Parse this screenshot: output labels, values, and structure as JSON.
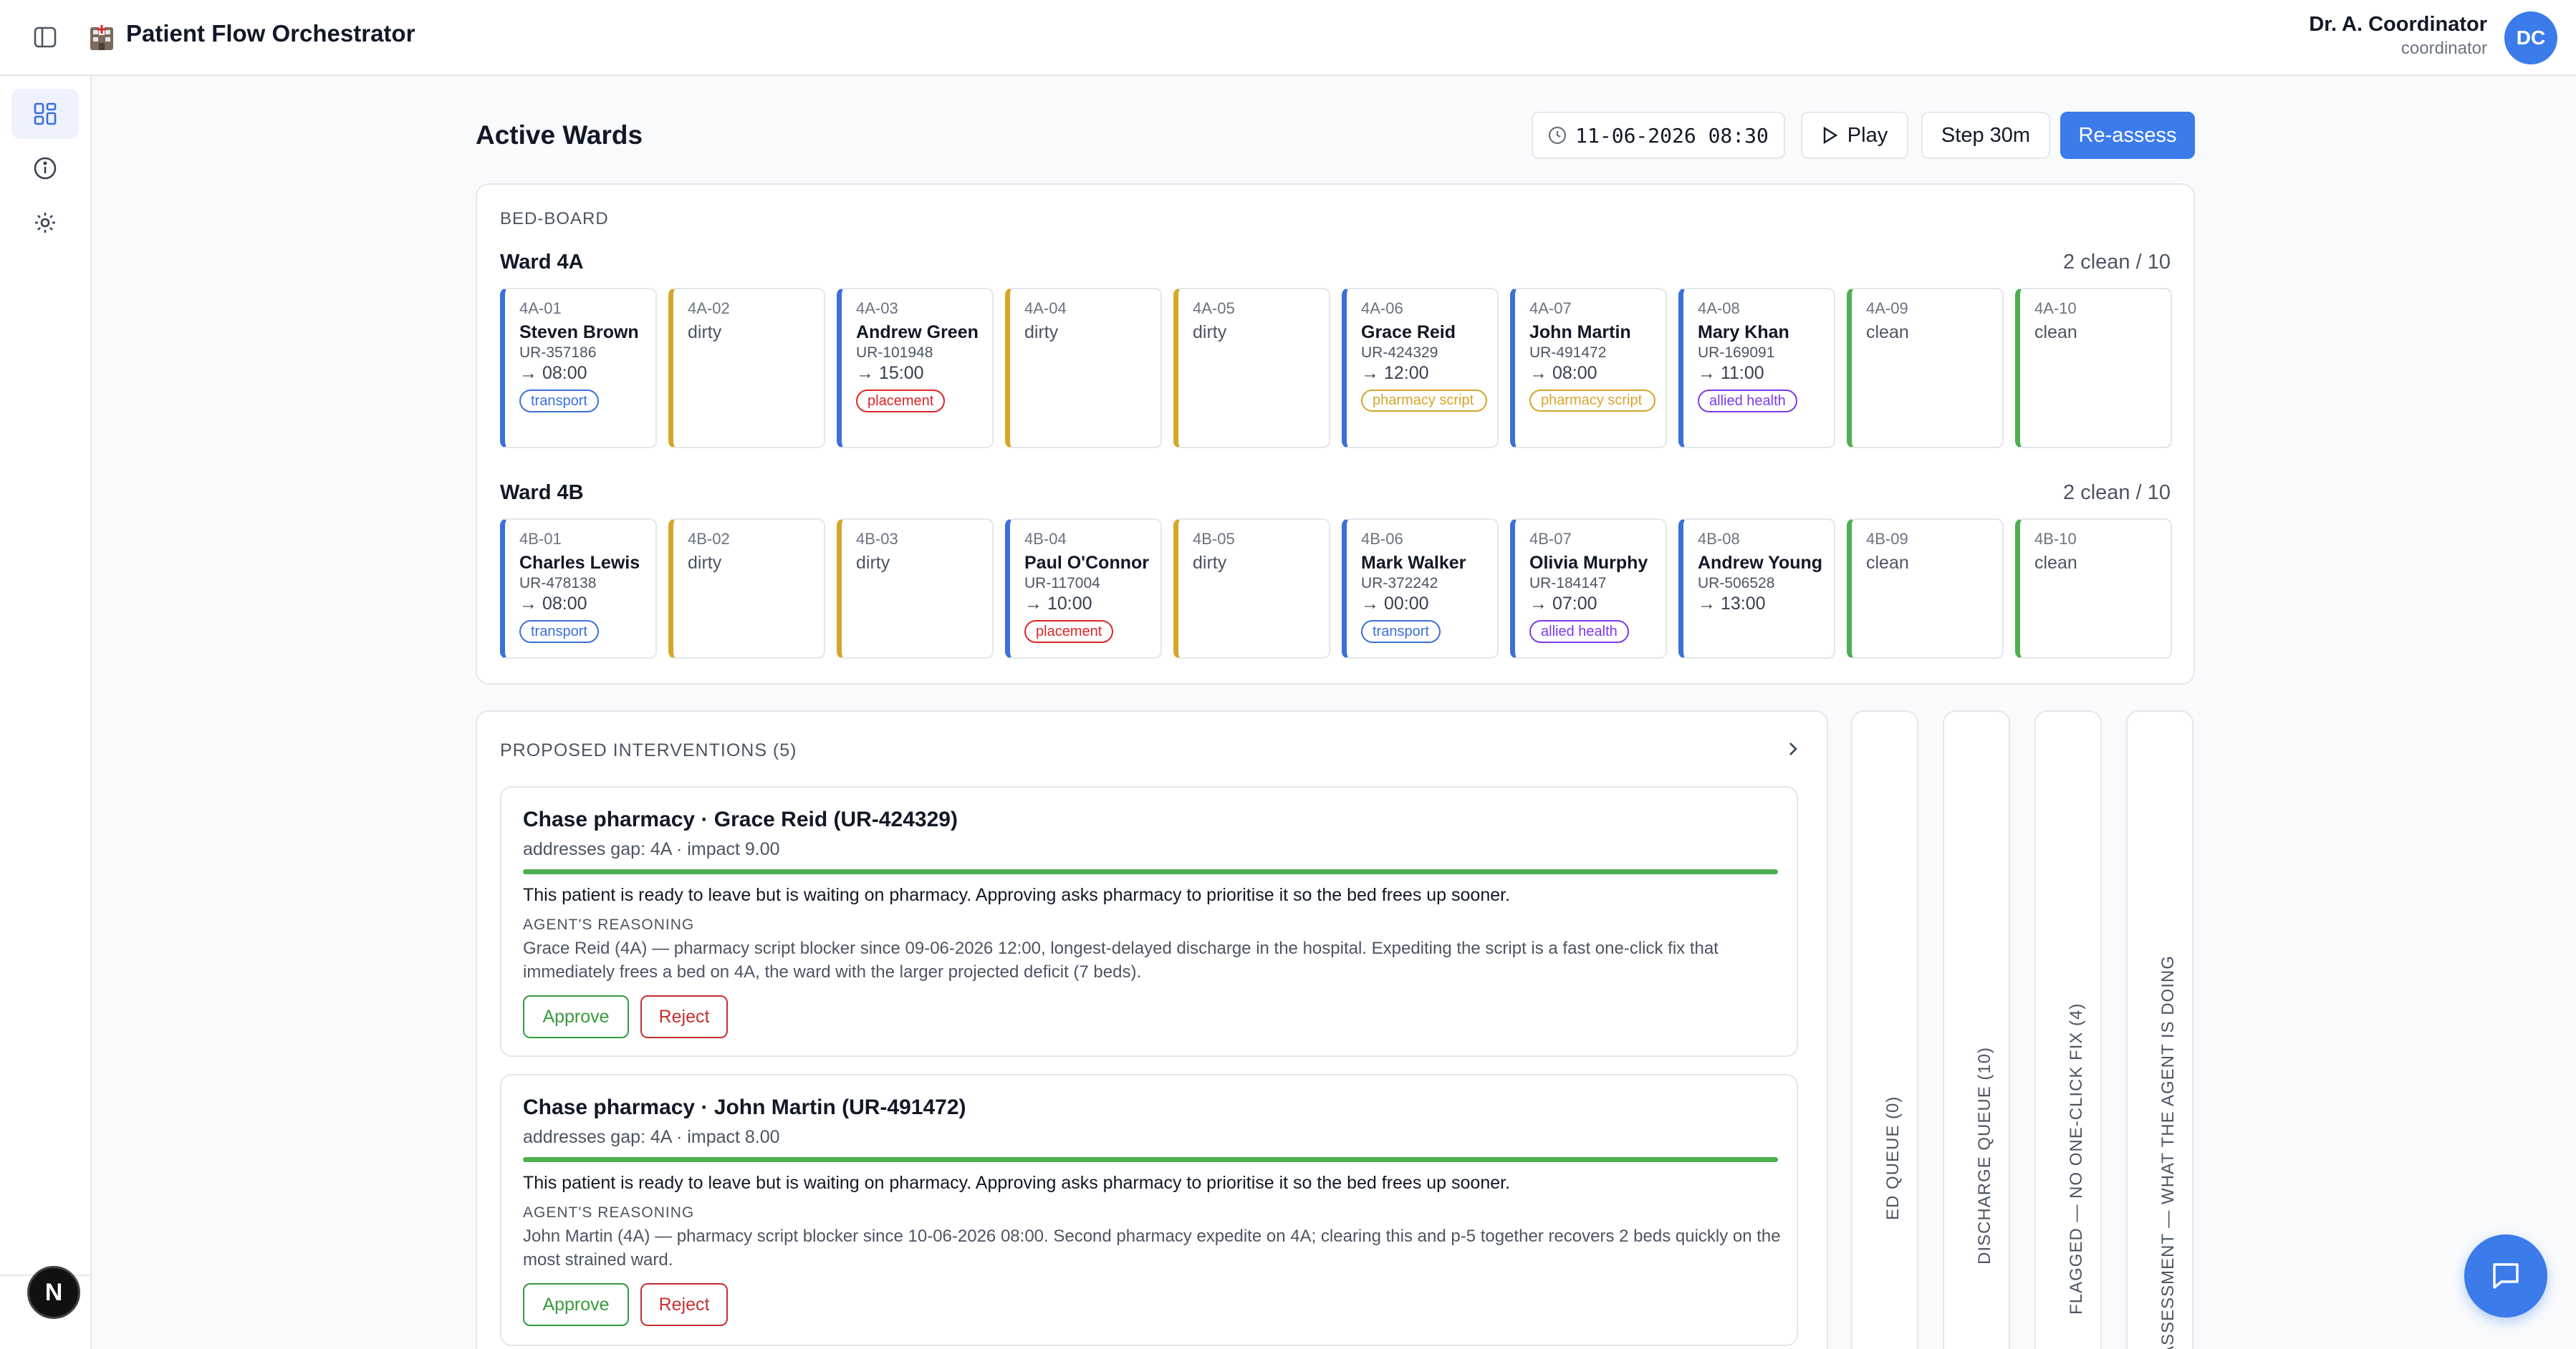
{
  "app": {
    "title": "Patient Flow Orchestrator"
  },
  "user": {
    "name": "Dr. A. Coordinator",
    "role": "coordinator",
    "initials": "DC"
  },
  "page": {
    "title": "Active Wards",
    "datetime": "11-06-2026 08:30",
    "play_label": "Play",
    "step_label": "Step 30m",
    "reassess_label": "Re-assess"
  },
  "bedboard": {
    "label": "BED-BOARD",
    "wards": [
      {
        "name": "Ward 4A",
        "summary": "2 clean / 10",
        "beds": [
          {
            "id": "4A-01",
            "state": "occupied",
            "name": "Steven Brown",
            "ur": "UR-357186",
            "time": "→ 08:00",
            "tag": "transport",
            "tag_type": "transport"
          },
          {
            "id": "4A-02",
            "state": "dirty",
            "status": "dirty"
          },
          {
            "id": "4A-03",
            "state": "occupied",
            "name": "Andrew Green",
            "ur": "UR-101948",
            "time": "→ 15:00",
            "tag": "placement",
            "tag_type": "placement"
          },
          {
            "id": "4A-04",
            "state": "dirty",
            "status": "dirty"
          },
          {
            "id": "4A-05",
            "state": "dirty",
            "status": "dirty"
          },
          {
            "id": "4A-06",
            "state": "occupied",
            "name": "Grace Reid",
            "ur": "UR-424329",
            "time": "→ 12:00",
            "tag": "pharmacy script",
            "tag_type": "pharmacy"
          },
          {
            "id": "4A-07",
            "state": "occupied",
            "name": "John Martin",
            "ur": "UR-491472",
            "time": "→ 08:00",
            "tag": "pharmacy script",
            "tag_type": "pharmacy"
          },
          {
            "id": "4A-08",
            "state": "occupied",
            "name": "Mary Khan",
            "ur": "UR-169091",
            "time": "→ 11:00",
            "tag": "allied health",
            "tag_type": "allied"
          },
          {
            "id": "4A-09",
            "state": "clean",
            "status": "clean"
          },
          {
            "id": "4A-10",
            "state": "clean",
            "status": "clean"
          }
        ]
      },
      {
        "name": "Ward 4B",
        "summary": "2 clean / 10",
        "beds": [
          {
            "id": "4B-01",
            "state": "occupied",
            "name": "Charles Lewis",
            "ur": "UR-478138",
            "time": "→ 08:00",
            "tag": "transport",
            "tag_type": "transport"
          },
          {
            "id": "4B-02",
            "state": "dirty",
            "status": "dirty"
          },
          {
            "id": "4B-03",
            "state": "dirty",
            "status": "dirty"
          },
          {
            "id": "4B-04",
            "state": "occupied",
            "name": "Paul O'Connor",
            "ur": "UR-117004",
            "time": "→ 10:00",
            "tag": "placement",
            "tag_type": "placement"
          },
          {
            "id": "4B-05",
            "state": "dirty",
            "status": "dirty"
          },
          {
            "id": "4B-06",
            "state": "occupied",
            "name": "Mark Walker",
            "ur": "UR-372242",
            "time": "→ 00:00",
            "tag": "transport",
            "tag_type": "transport"
          },
          {
            "id": "4B-07",
            "state": "occupied",
            "name": "Olivia Murphy",
            "ur": "UR-184147",
            "time": "→ 07:00",
            "tag": "allied health",
            "tag_type": "allied"
          },
          {
            "id": "4B-08",
            "state": "occupied",
            "name": "Andrew Young",
            "ur": "UR-506528",
            "time": "→ 13:00"
          },
          {
            "id": "4B-09",
            "state": "clean",
            "status": "clean"
          },
          {
            "id": "4B-10",
            "state": "clean",
            "status": "clean"
          }
        ]
      }
    ]
  },
  "interventions": {
    "label": "PROPOSED INTERVENTIONS (5)",
    "reasoning_label": "AGENT'S REASONING",
    "approve_label": "Approve",
    "reject_label": "Reject",
    "items": [
      {
        "title": "Chase pharmacy · Grace Reid (UR-424329)",
        "meta": "addresses gap: 4A · impact 9.00",
        "description": "This patient is ready to leave but is waiting on pharmacy. Approving asks pharmacy to prioritise it so the bed frees up sooner.",
        "reasoning": "Grace Reid (4A) — pharmacy script blocker since 09-06-2026 12:00, longest-delayed discharge in the hospital. Expediting the script is a fast one-click fix that immediately frees a bed on 4A, the ward with the larger projected deficit (7 beds)."
      },
      {
        "title": "Chase pharmacy · John Martin (UR-491472)",
        "meta": "addresses gap: 4A · impact 8.00",
        "description": "This patient is ready to leave but is waiting on pharmacy. Approving asks pharmacy to prioritise it so the bed frees up sooner.",
        "reasoning": "John Martin (4A) — pharmacy script blocker since 10-06-2026 08:00. Second pharmacy expedite on 4A; clearing this and p-5 together recovers 2 beds quickly on the most strained ward."
      }
    ]
  },
  "panels": [
    {
      "label": "ED QUEUE (0)"
    },
    {
      "label": "DISCHARGE QUEUE (10)"
    },
    {
      "label": "FLAGGED — NO ONE-CLICK FIX (4)"
    },
    {
      "label": "ASSESSMENT — WHAT THE AGENT IS DOING"
    }
  ],
  "colors": {
    "accent": "#3b7bea",
    "occupied": "#3b6fd9",
    "dirty": "#d4a62a",
    "clean": "#4caf50",
    "reject": "#c53030"
  }
}
